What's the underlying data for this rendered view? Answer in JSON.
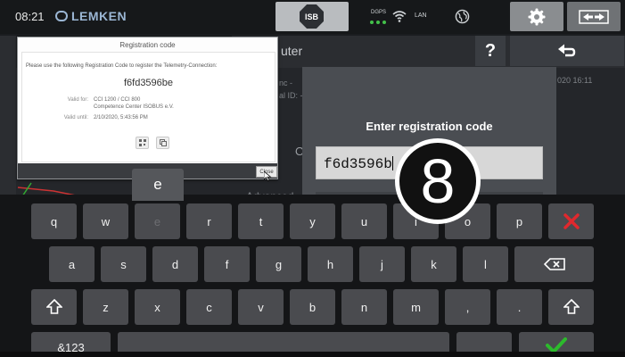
{
  "topbar": {
    "time": "08:21",
    "logo": "LEMKEN",
    "isb_label": "ISB",
    "dgps_label": "DGPS",
    "lan_label": "LAN",
    "icons": [
      "wifi-icon",
      "globe-icon",
      "gear-icon",
      "swap-arrows-icon"
    ]
  },
  "background": {
    "title_fragment": "uter",
    "help_label": "?",
    "fragments": [
      "nc -",
      "al ID: -",
      "020 16:11",
      "O",
      "Advanced"
    ]
  },
  "registration_dialog": {
    "title": "Registration code",
    "message": "Please use the following Registration Code to register the Telemetry-Connection:",
    "code": "f6fd3596be",
    "valid_for_label": "Valid for:",
    "valid_for_line1": "CCI 1200 / CCI 800",
    "valid_for_line2": "Competence Center ISOBUS e.V.",
    "valid_until_label": "Valid until:",
    "valid_until": "2/10/2020, 5:43:56 PM",
    "close_label": "Close"
  },
  "code_entry": {
    "label": "Enter registration code",
    "value": "f6d3596b"
  },
  "step_marker": "8",
  "keyboard": {
    "popup_key": "e",
    "row1": [
      "q",
      "w",
      "e",
      "r",
      "t",
      "y",
      "u",
      "i",
      "o",
      "p"
    ],
    "row2": [
      "a",
      "s",
      "d",
      "f",
      "g",
      "h",
      "j",
      "k",
      "l"
    ],
    "row3": [
      "z",
      "x",
      "c",
      "v",
      "b",
      "n",
      "m",
      ",",
      "."
    ],
    "symbols_label": "&123",
    "colors": {
      "cancel": "#e0282d",
      "confirm": "#2cba2c"
    }
  }
}
